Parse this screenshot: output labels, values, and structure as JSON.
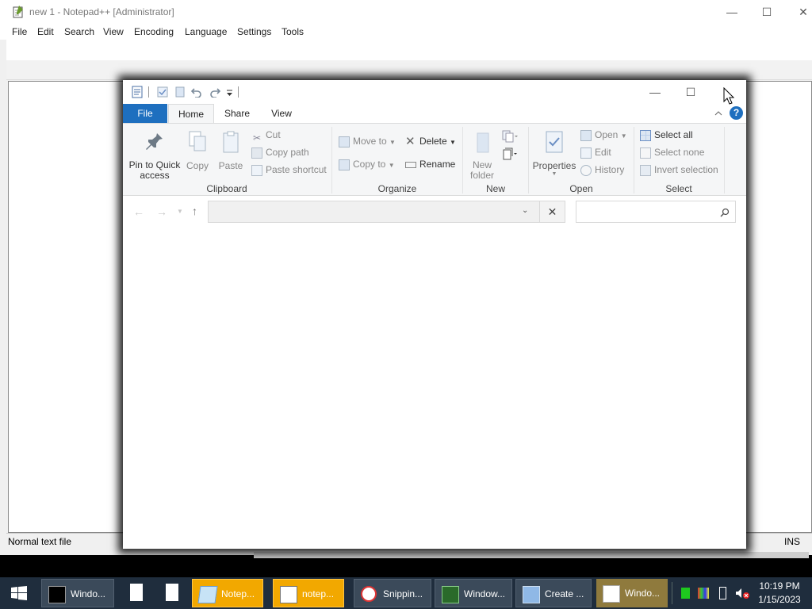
{
  "notepad": {
    "title": "new 1 - Notepad++ [Administrator]",
    "menu": [
      "File",
      "Edit",
      "Search",
      "View",
      "Encoding",
      "Language",
      "Settings",
      "Tools"
    ],
    "status_left": "Normal text file",
    "status_right": "INS"
  },
  "explorer": {
    "tabs": {
      "file": "File",
      "home": "Home",
      "share": "Share",
      "view": "View"
    },
    "clipboard": {
      "pin": "Pin to Quick access",
      "copy": "Copy",
      "paste": "Paste",
      "cut": "Cut",
      "copy_path": "Copy path",
      "paste_shortcut": "Paste shortcut",
      "label": "Clipboard"
    },
    "organize": {
      "move_to": "Move to",
      "copy_to": "Copy to",
      "delete": "Delete",
      "rename": "Rename",
      "label": "Organize"
    },
    "new": {
      "new_folder": "New folder",
      "label": "New"
    },
    "open": {
      "properties": "Properties",
      "open": "Open",
      "edit": "Edit",
      "history": "History",
      "label": "Open"
    },
    "select": {
      "select_all": "Select all",
      "select_none": "Select none",
      "invert": "Invert selection",
      "label": "Select"
    },
    "address": "",
    "search_placeholder": ""
  },
  "taskbar": {
    "items": [
      "Windo...",
      "Notep...",
      "notep...",
      "Snippin...",
      "Window...",
      "Create ...",
      "Windo..."
    ],
    "time": "10:19 PM",
    "date": "1/15/2023"
  },
  "colors": {
    "file_tab": "#1e6fbf",
    "taskbar": "#1f2d3d",
    "active_yellow": "#f2a800",
    "help": "#1e6fbf"
  }
}
